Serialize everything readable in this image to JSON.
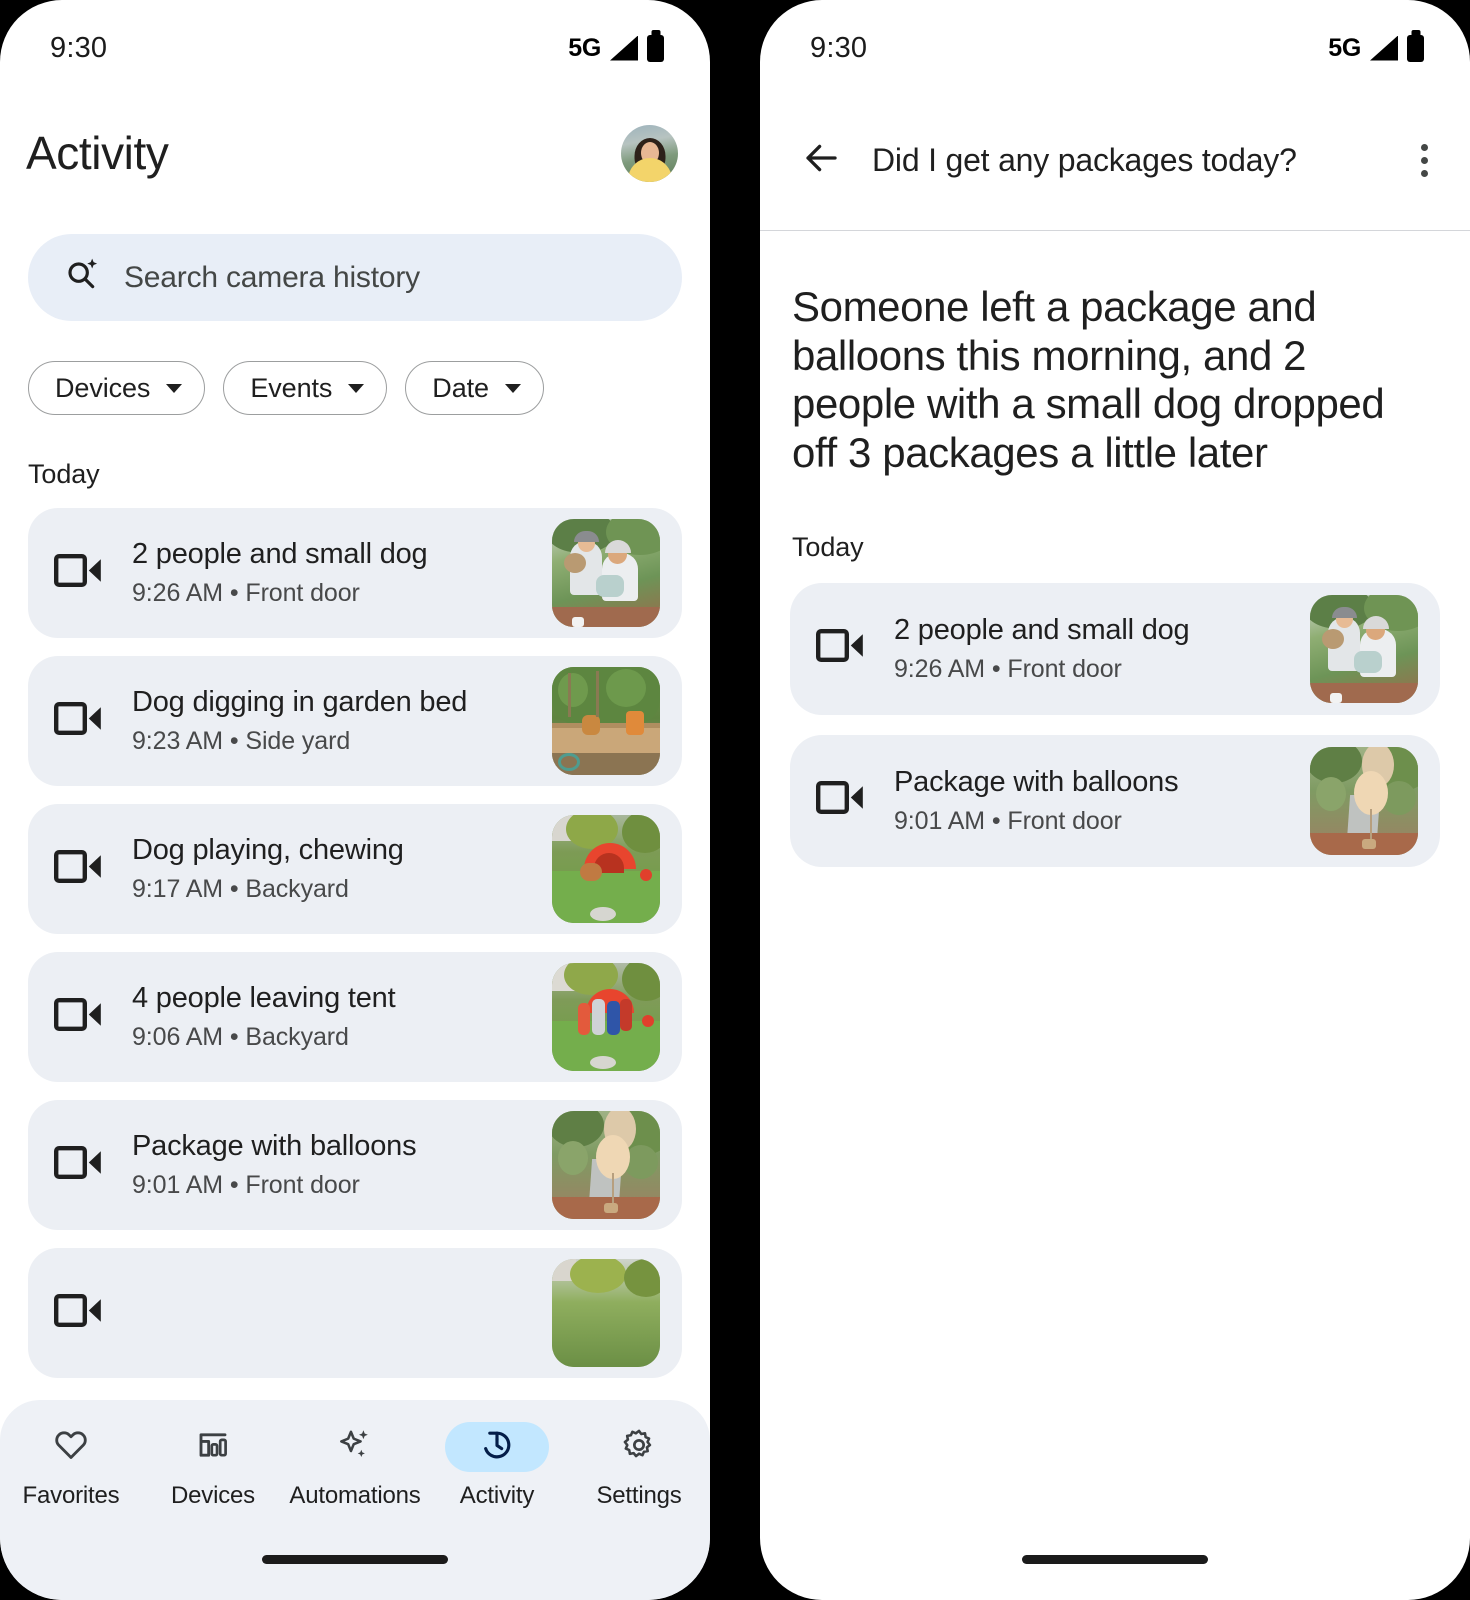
{
  "status_bar": {
    "time": "9:30",
    "network": "5G",
    "signal_icon": "signal-triangle-icon",
    "battery_icon": "battery-full-icon"
  },
  "left_phone": {
    "header": {
      "title": "Activity",
      "avatar_icon": "user-avatar"
    },
    "search": {
      "icon": "ai-search-icon",
      "placeholder": "Search camera history",
      "value": ""
    },
    "filters": [
      {
        "label": "Devices",
        "icon": "chevron-down-icon"
      },
      {
        "label": "Events",
        "icon": "chevron-down-icon"
      },
      {
        "label": "Date",
        "icon": "chevron-down-icon"
      }
    ],
    "section_label": "Today",
    "events": [
      {
        "title": "2 people and small dog",
        "time": "9:26 AM",
        "separator": "•",
        "location": "Front door",
        "icon": "video-camera-icon",
        "thumb": "two-people-dog"
      },
      {
        "title": "Dog digging in garden bed",
        "time": "9:23 AM",
        "separator": "•",
        "location": "Side yard",
        "icon": "video-camera-icon",
        "thumb": "garden-bed"
      },
      {
        "title": "Dog playing, chewing",
        "time": "9:17 AM",
        "separator": "•",
        "location": "Backyard",
        "icon": "video-camera-icon",
        "thumb": "dog-tent"
      },
      {
        "title": "4 people leaving tent",
        "time": "9:06 AM",
        "separator": "•",
        "location": "Backyard",
        "icon": "video-camera-icon",
        "thumb": "people-tent"
      },
      {
        "title": "Package with balloons",
        "time": "9:01 AM",
        "separator": "•",
        "location": "Front door",
        "icon": "video-camera-icon",
        "thumb": "balloons"
      }
    ],
    "bottom_nav": {
      "active": "Activity",
      "items": [
        {
          "label": "Favorites",
          "icon": "heart-icon",
          "active": false
        },
        {
          "label": "Devices",
          "icon": "devices-icon",
          "active": false
        },
        {
          "label": "Automations",
          "icon": "sparkle-icon",
          "active": false
        },
        {
          "label": "Activity",
          "icon": "history-icon",
          "active": true
        },
        {
          "label": "Settings",
          "icon": "gear-icon",
          "active": false
        }
      ]
    },
    "colors": {
      "active_pill": "#c2e7ff",
      "card_bg": "#eceff4",
      "search_bg": "#e8eef7",
      "nav_bg": "#eef1f6"
    }
  },
  "right_phone": {
    "header": {
      "back_icon": "back-arrow-icon",
      "title": "Did I get any packages today?",
      "menu_icon": "more-vertical-icon"
    },
    "answer": "Someone left a package and balloons this morning, and 2 people with a small dog dropped off 3 packages a little later",
    "section_label": "Today",
    "events": [
      {
        "title": "2 people and small dog",
        "time": "9:26 AM",
        "separator": "•",
        "location": "Front door",
        "icon": "video-camera-icon",
        "thumb": "two-people-dog"
      },
      {
        "title": "Package with balloons",
        "time": "9:01 AM",
        "separator": "•",
        "location": "Front door",
        "icon": "video-camera-icon",
        "thumb": "balloons"
      }
    ]
  }
}
